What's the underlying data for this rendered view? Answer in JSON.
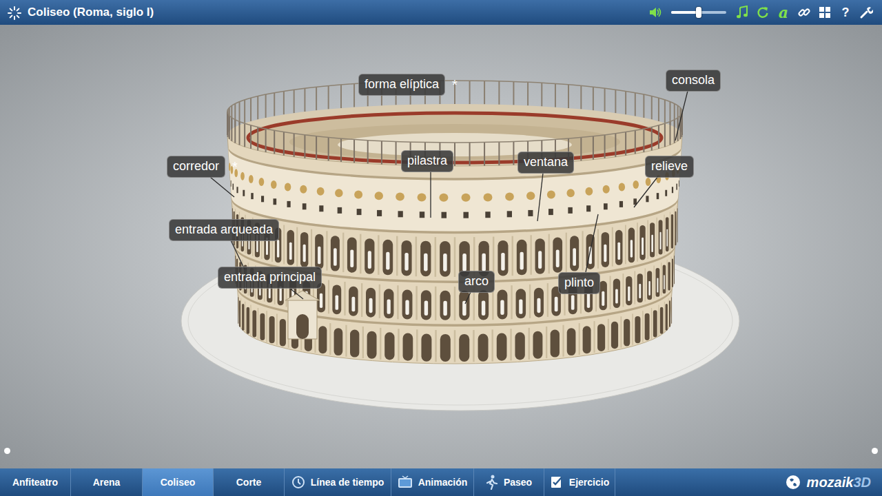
{
  "window": {
    "title": "Coliseo (Roma, siglo I)"
  },
  "toolbar": {
    "volume": {
      "level": 0.5
    },
    "font_button": "a",
    "help_button": "?"
  },
  "labels": [
    {
      "text": "forma elíptica",
      "asterisk": "*"
    },
    {
      "text": "consola"
    },
    {
      "text": "corredor",
      "asterisk": "*"
    },
    {
      "text": "pilastra"
    },
    {
      "text": "ventana"
    },
    {
      "text": "relieve"
    },
    {
      "text": "entrada arqueada"
    },
    {
      "text": "entrada principal"
    },
    {
      "text": "arco"
    },
    {
      "text": "plinto"
    }
  ],
  "tabs": [
    {
      "label": "Anfiteatro",
      "kind": "text",
      "selected": false
    },
    {
      "label": "Arena",
      "kind": "text",
      "selected": false
    },
    {
      "label": "Coliseo",
      "kind": "text",
      "selected": true
    },
    {
      "label": "Corte",
      "kind": "text",
      "selected": false
    },
    {
      "label": "Línea de tiempo",
      "kind": "icon",
      "selected": false
    },
    {
      "label": "Animación",
      "kind": "icon",
      "selected": false
    },
    {
      "label": "Paseo",
      "kind": "icon",
      "selected": false
    },
    {
      "label": "Ejercicio",
      "kind": "icon",
      "selected": false
    }
  ],
  "logo": {
    "name": "mozaik",
    "suffix": "3D"
  }
}
